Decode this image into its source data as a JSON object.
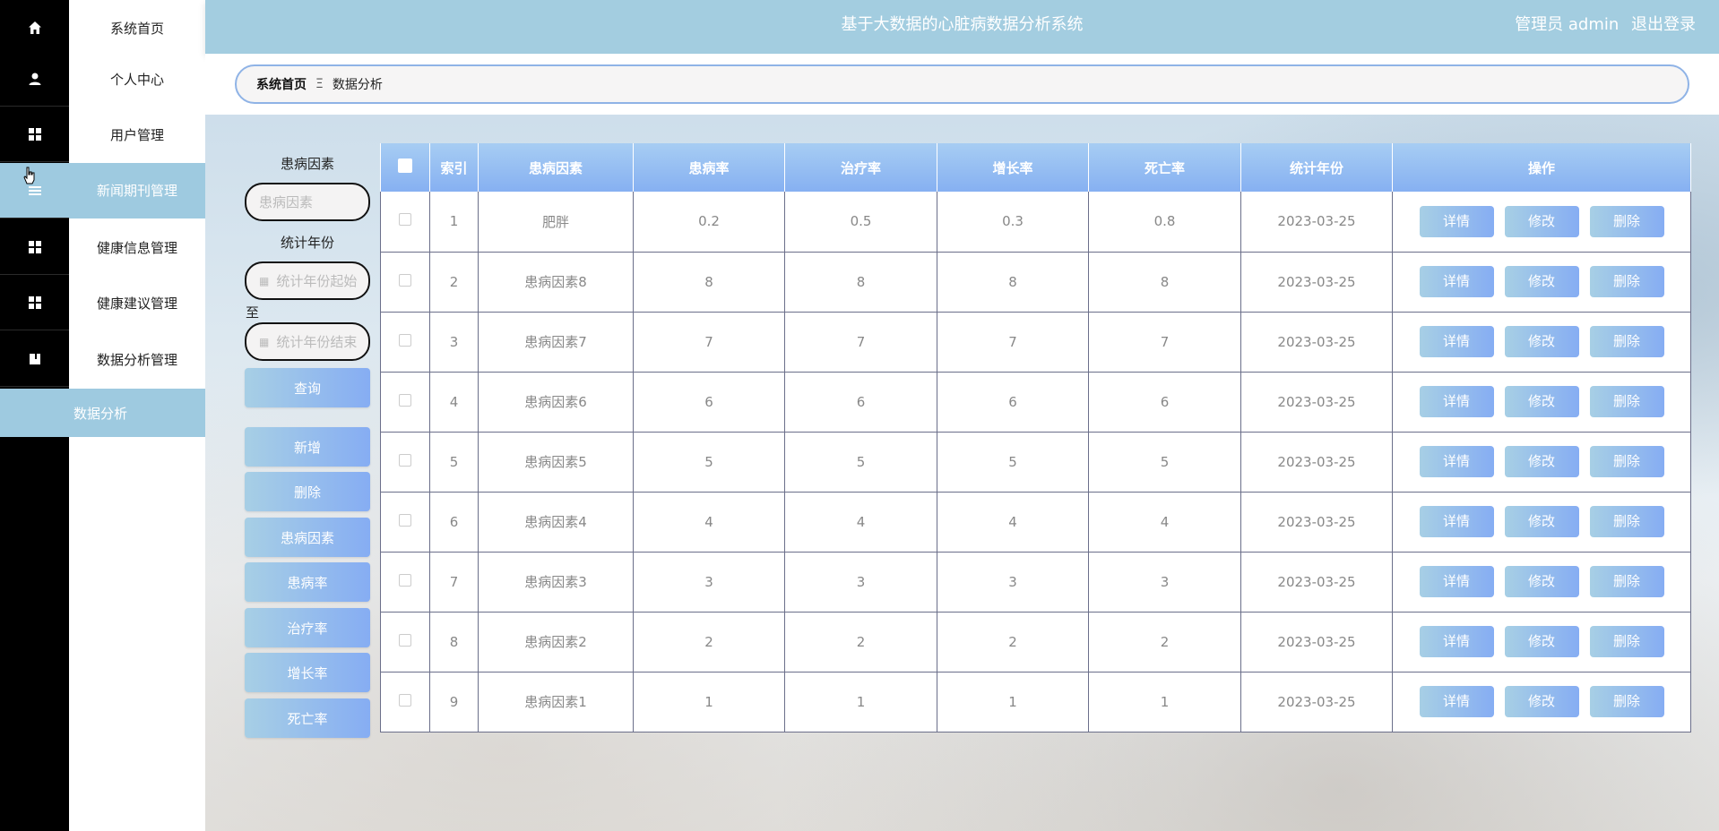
{
  "header": {
    "title": "基于大数据的心脏病数据分析系统",
    "user": "管理员 admin",
    "logout": "退出登录"
  },
  "sidebar": {
    "items": [
      {
        "label": "系统首页",
        "icon": "home-icon"
      },
      {
        "label": "个人中心",
        "icon": "user-icon"
      },
      {
        "label": "用户管理",
        "icon": "grid-icon"
      },
      {
        "label": "新闻期刊管理",
        "icon": "list-icon"
      },
      {
        "label": "健康信息管理",
        "icon": "grid-icon"
      },
      {
        "label": "健康建议管理",
        "icon": "grid-icon"
      },
      {
        "label": "数据分析管理",
        "icon": "book-icon"
      }
    ],
    "sub_item": "数据分析"
  },
  "breadcrumb": {
    "home": "系统首页",
    "separator": "Ξ",
    "current": "数据分析"
  },
  "filters": {
    "factor_label": "患病因素",
    "factor_placeholder": "患病因素",
    "year_label": "统计年份",
    "year_start_placeholder": "统计年份起始",
    "to": "至",
    "year_end_placeholder": "统计年份结束",
    "query": "查询"
  },
  "actions": [
    "新增",
    "删除",
    "患病因素",
    "患病率",
    "治疗率",
    "增长率",
    "死亡率"
  ],
  "table": {
    "columns": [
      "索引",
      "患病因素",
      "患病率",
      "治疗率",
      "增长率",
      "死亡率",
      "统计年份",
      "操作"
    ],
    "rows": [
      [
        "1",
        "肥胖",
        "0.2",
        "0.5",
        "0.3",
        "0.8",
        "2023-03-25"
      ],
      [
        "2",
        "患病因素8",
        "8",
        "8",
        "8",
        "8",
        "2023-03-25"
      ],
      [
        "3",
        "患病因素7",
        "7",
        "7",
        "7",
        "7",
        "2023-03-25"
      ],
      [
        "4",
        "患病因素6",
        "6",
        "6",
        "6",
        "6",
        "2023-03-25"
      ],
      [
        "5",
        "患病因素5",
        "5",
        "5",
        "5",
        "5",
        "2023-03-25"
      ],
      [
        "6",
        "患病因素4",
        "4",
        "4",
        "4",
        "4",
        "2023-03-25"
      ],
      [
        "7",
        "患病因素3",
        "3",
        "3",
        "3",
        "3",
        "2023-03-25"
      ],
      [
        "8",
        "患病因素2",
        "2",
        "2",
        "2",
        "2",
        "2023-03-25"
      ],
      [
        "9",
        "患病因素1",
        "1",
        "1",
        "1",
        "1",
        "2023-03-25"
      ]
    ],
    "row_actions": [
      "详情",
      "修改",
      "删除"
    ]
  },
  "colors": {
    "header": "#a3cde0",
    "accent": "#86adf3",
    "sidebar_active": "#9ecae0"
  }
}
